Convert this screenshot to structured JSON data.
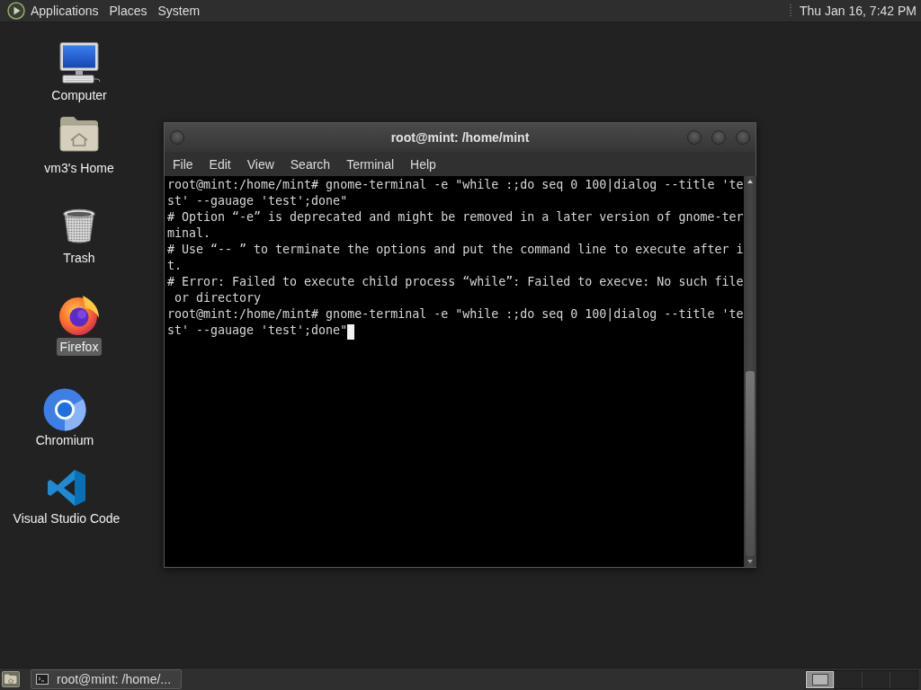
{
  "top_panel": {
    "menus": [
      "Applications",
      "Places",
      "System"
    ],
    "clock": "Thu Jan 16, 7:42 PM"
  },
  "desktop_icons": [
    {
      "kind": "computer",
      "label": "Computer",
      "selected": false
    },
    {
      "kind": "home",
      "label": "vm3's Home",
      "selected": false
    },
    {
      "kind": "trash",
      "label": "Trash",
      "selected": false
    },
    {
      "kind": "firefox",
      "label": "Firefox",
      "selected": true
    },
    {
      "kind": "chromium",
      "label": "Chromium",
      "selected": false
    },
    {
      "kind": "vscode",
      "label": "Visual Studio Code",
      "selected": false
    }
  ],
  "terminal_window": {
    "title": "root@mint: /home/mint",
    "menus": [
      "File",
      "Edit",
      "View",
      "Search",
      "Terminal",
      "Help"
    ],
    "lines": [
      "root@mint:/home/mint# gnome-terminal -e \"while :;do seq 0 100|dialog --title 'test' --gauage 'test';done\"",
      "# Option “-e” is deprecated and might be removed in a later version of gnome-terminal.",
      "# Use “-- ” to terminate the options and put the command line to execute after it.",
      "# Error: Failed to execute child process “while”: Failed to execve: No such file or directory",
      "root@mint:/home/mint# gnome-terminal -e \"while :;do seq 0 100|dialog --title 'test' --gauage 'test';done\""
    ],
    "cursor": true
  },
  "taskbar": {
    "tasks": [
      {
        "label": "root@mint: /home/..."
      }
    ],
    "workspaces": [
      {
        "selected": true
      },
      {
        "selected": false
      },
      {
        "selected": false
      },
      {
        "selected": false
      }
    ]
  }
}
